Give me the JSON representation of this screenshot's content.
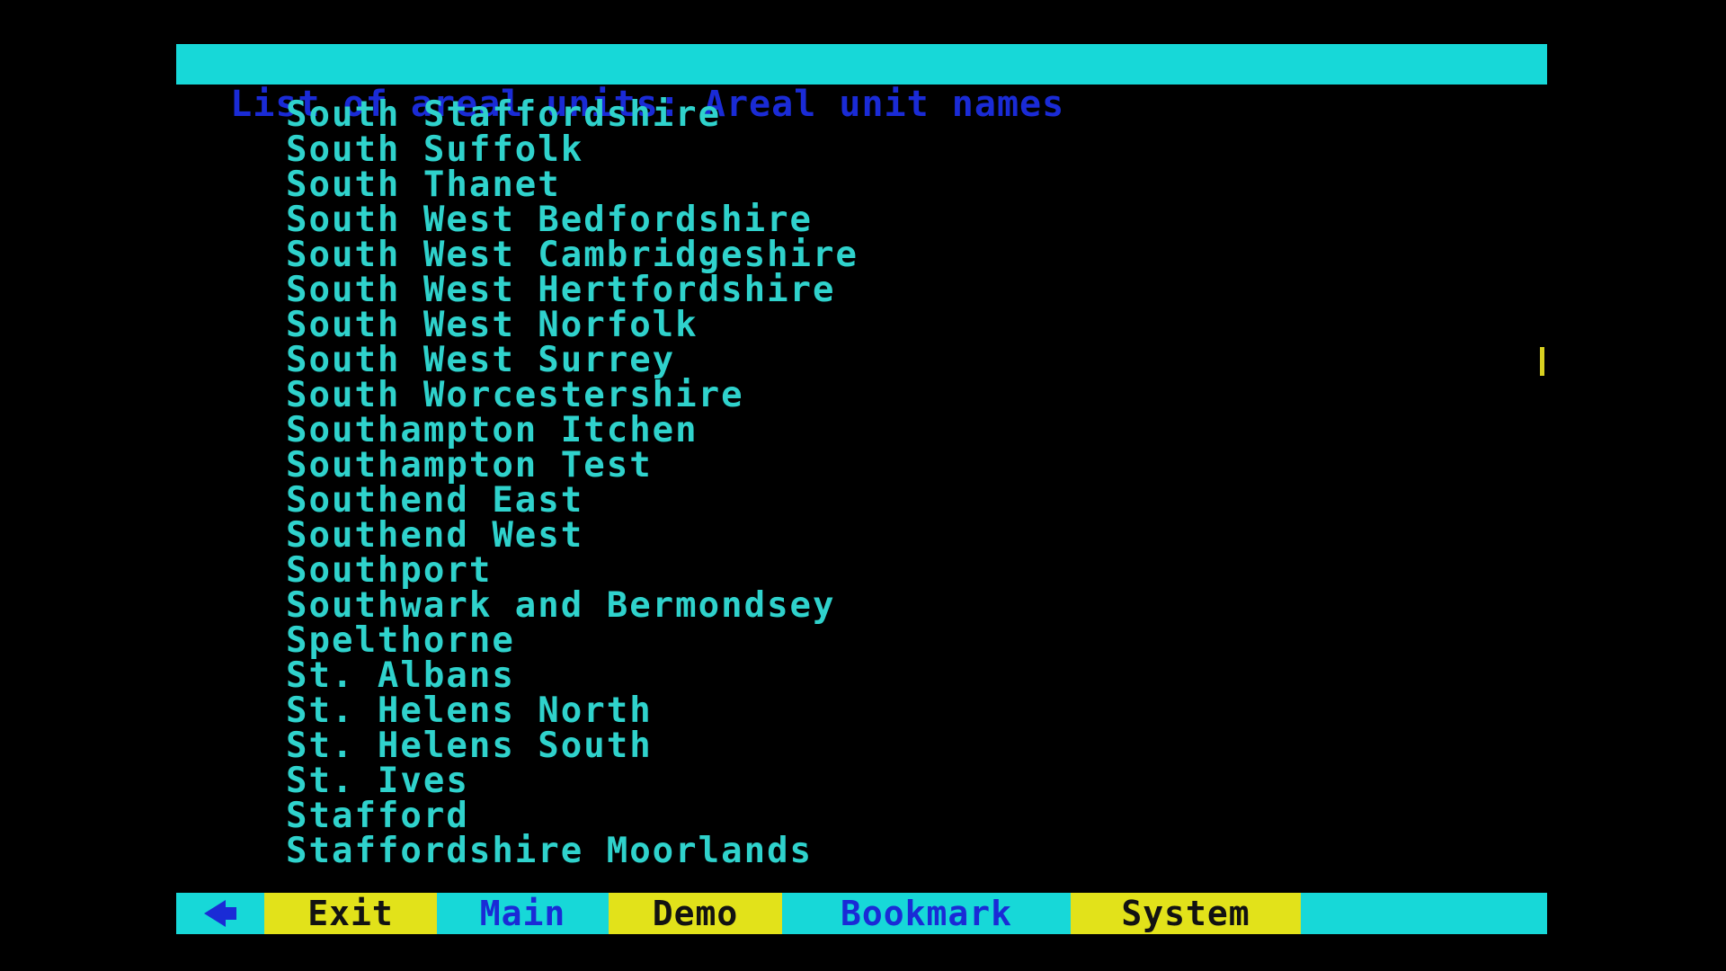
{
  "header": {
    "title": "List of areal units: Areal unit names"
  },
  "list": {
    "items": [
      "South Staffordshire",
      "South Suffolk",
      "South Thanet",
      "South West Bedfordshire",
      "South West Cambridgeshire",
      "South West Hertfordshire",
      "South West Norfolk",
      "South West Surrey",
      "South Worcestershire",
      "Southampton Itchen",
      "Southampton Test",
      "Southend East",
      "Southend West",
      "Southport",
      "Southwark and Bermondsey",
      "Spelthorne",
      "St. Albans",
      "St. Helens North",
      "St. Helens South",
      "St. Ives",
      "Stafford",
      "Staffordshire Moorlands"
    ]
  },
  "nav": {
    "back_icon": "left-arrow-icon",
    "exit_label": "Exit",
    "main_label": "Main",
    "demo_label": "Demo",
    "bookmark_label": "Bookmark",
    "system_label": "System"
  },
  "colors": {
    "background": "#000000",
    "bar_cyan": "#17d8d8",
    "bar_yellow": "#e2e21a",
    "title_text": "#1a2bd6",
    "list_text": "#2fd2cc",
    "cursor": "#d8d020"
  }
}
